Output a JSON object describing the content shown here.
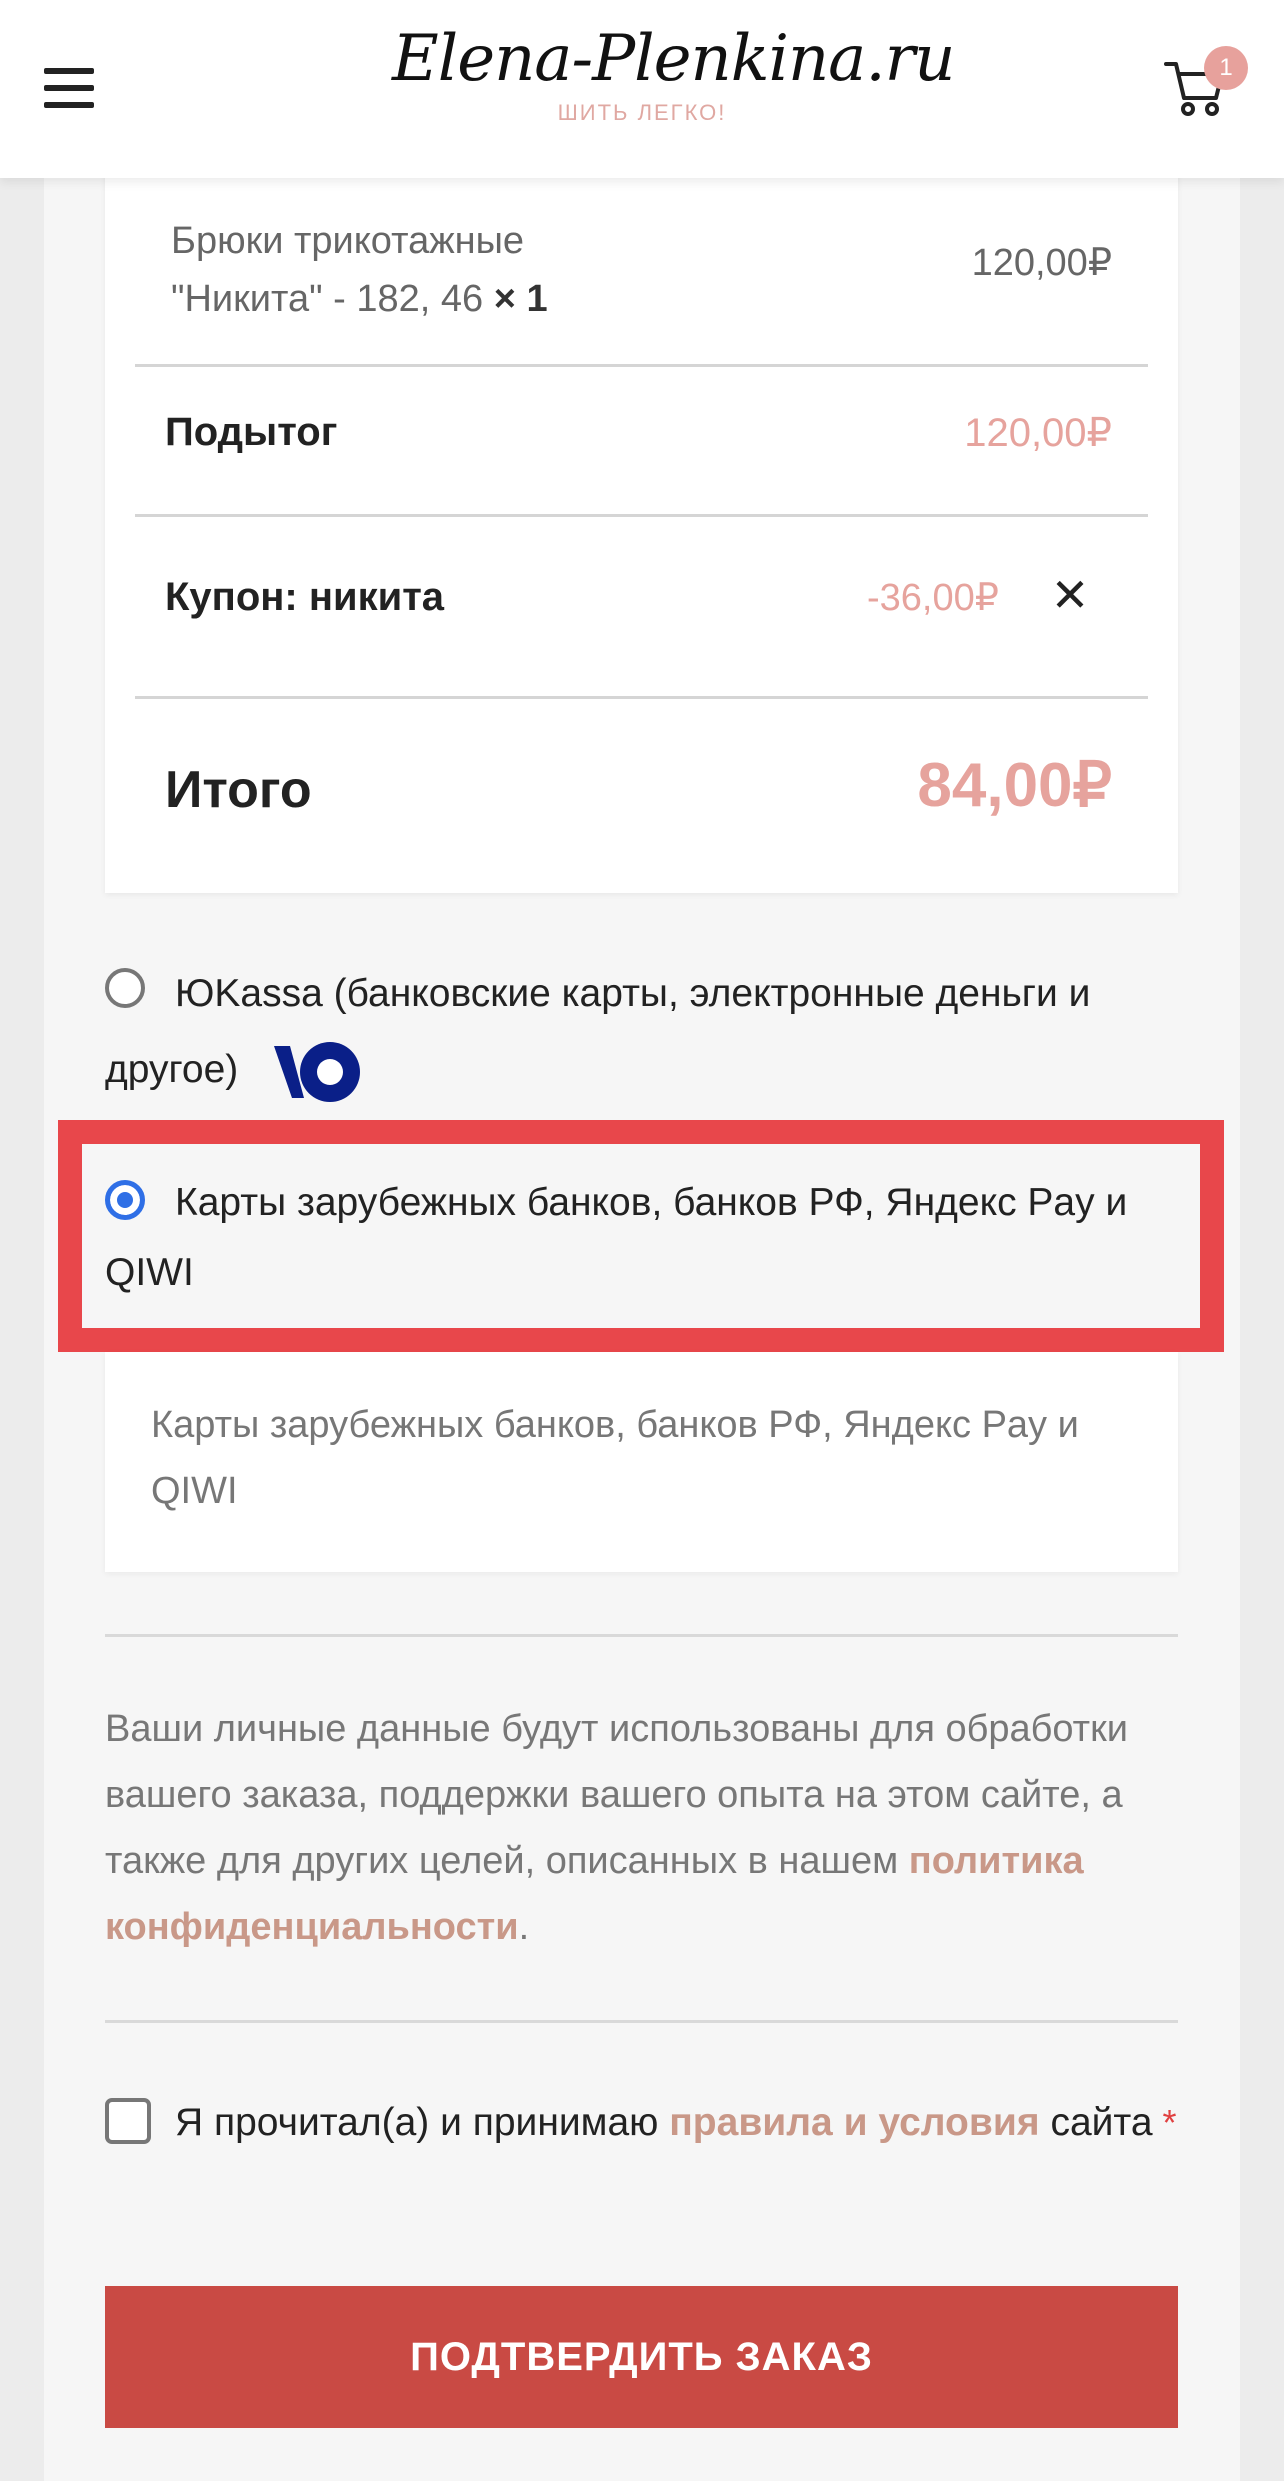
{
  "header": {
    "logo_text": "Elena-Plenkina.ru",
    "logo_tagline": "ШИТЬ ЛЕГКО!",
    "cart_count": "1"
  },
  "order": {
    "product_name": "Брюки трикотажные \"Никита\" - 182, 46",
    "product_qty": "× 1",
    "product_price": "120,00₽",
    "subtotal_label": "Подытог",
    "subtotal_value": "120,00₽",
    "coupon_label": "Купон: никита",
    "coupon_value": "-36,00₽",
    "total_label": "Итого",
    "total_value": "84,00₽"
  },
  "payment": {
    "methods": [
      {
        "label": "ЮKassa (банковские карты, электронные деньги и другое)",
        "selected": false
      },
      {
        "label": "Карты зарубежных банков, банков РФ, Яндекс Pay и QIWI",
        "selected": true
      }
    ],
    "description": "Карты зарубежных банков, банков РФ, Яндекс Pay и QIWI"
  },
  "privacy": {
    "text": "Ваши личные данные будут использованы для обработки вашего заказа, поддержки вашего опыта на этом сайте, а также для других целей, описанных в нашем",
    "link": "политика конфиденциальности",
    "end": "."
  },
  "terms": {
    "text": "Я прочитал(а) и принимаю",
    "link": "правила и условия",
    "suffix": "сайта",
    "required_mark": "*"
  },
  "confirm_button": "ПОДТВЕРДИТЬ ЗАКАЗ",
  "colors": {
    "accent_pink": "#e6a39d",
    "link_tan": "#c99888",
    "button_red": "#c94a44",
    "highlight_red": "#e8474b",
    "radio_blue": "#2f6fe6"
  }
}
